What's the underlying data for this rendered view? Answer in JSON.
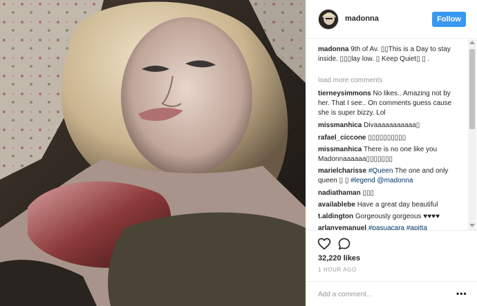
{
  "post": {
    "photo_label": "photo",
    "username": "madonna",
    "follow_label": "Follow",
    "caption": {
      "user": "madonna",
      "text": "9th of Av. ▯▯This is a Day to stay inside. ▯▯▯lay low. ▯ Keep Quiet▯ ▯ ."
    },
    "load_more": "load more comments",
    "comments": [
      {
        "user": "tierneysimmons",
        "text": "No likes.. Amazing not by her. That I see.. On comments guess cause she is super bizzy. Lol",
        "tag": "",
        "tail": ""
      },
      {
        "user": "missmanhica",
        "text": "Divaaaaaaaaaaa▯",
        "tag": "",
        "tail": ""
      },
      {
        "user": "rafael_ciccone",
        "text": "▯▯▯▯▯▯▯▯▯▯",
        "tag": "",
        "tail": ""
      },
      {
        "user": "missmanhica",
        "text": "There is no one like you Madonnaaaaaa▯▯▯▯▯▯▯",
        "tag": "",
        "tail": ""
      },
      {
        "user": "marielcharisse",
        "text": "",
        "tag": "#Queen",
        "tail": "The one and only queen ▯ ▯ ",
        "tag2": "#legend @madonna"
      },
      {
        "user": "nadiathaman",
        "text": "▯▯▯",
        "tag": "",
        "tail": ""
      },
      {
        "user": "availablebe",
        "text": "Have a great day beautiful",
        "tag": "",
        "tail": ""
      },
      {
        "user": "t.aldington",
        "text": "Gorgeously gorgeous ♥♥♥♥",
        "tag": "",
        "tail": ""
      },
      {
        "user": "arlanyemanuel",
        "text": "",
        "tag": "#pasuacara #apitta",
        "tail": ""
      }
    ],
    "likes": "32,220 likes",
    "time": "1 HOUR AGO",
    "add_comment_placeholder": "Add a comment...",
    "more_options": "•••"
  },
  "icons": {
    "like": "heart-icon",
    "comment": "comment-bubble-icon",
    "more": "more-options-icon"
  },
  "colors": {
    "follow_button": "#3897f0",
    "hashtag": "#003569",
    "muted": "#999999"
  }
}
